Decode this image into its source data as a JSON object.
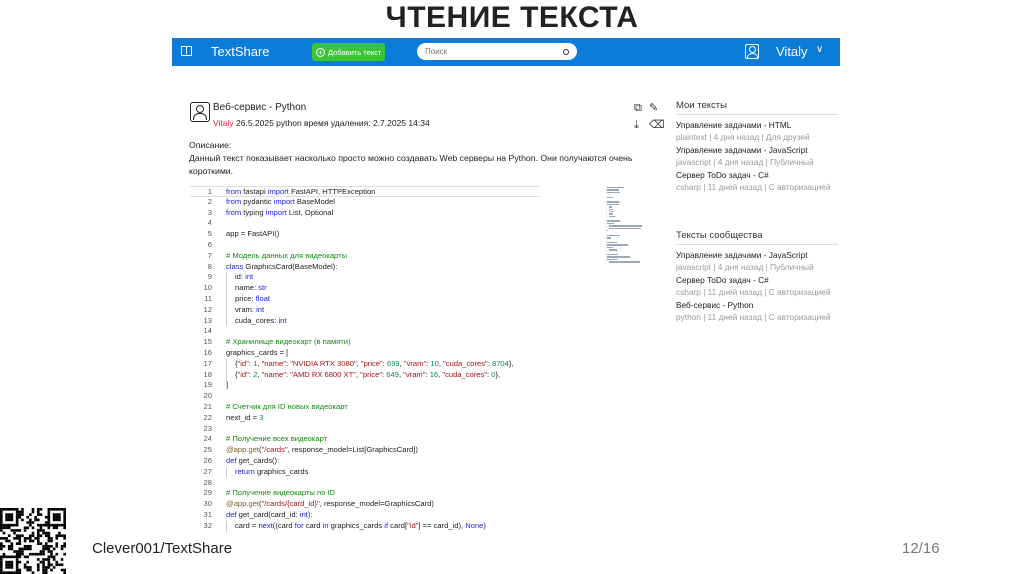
{
  "slide": {
    "title": "ЧТЕНИЕ ТЕКСТА",
    "repo": "Clever001/TextShare",
    "page": "12/16"
  },
  "navbar": {
    "brand": "TextShare",
    "add_button": "Добавить текст",
    "search_placeholder": "Поиск",
    "username": "Vitaly",
    "chevron": "∨"
  },
  "post": {
    "title": "Веб-сервис - Python",
    "author": "Vitaly",
    "meta": " 26.5.2025 python время удаления: 2.7.2025 14:34",
    "desc_label": "Описание:",
    "description": "Данный текст показывает насколько просто можно создавать Web серверы на Python. Они получаются очень короткими.",
    "actions": [
      {
        "name": "copy-icon",
        "glyph": "⧉"
      },
      {
        "name": "edit-icon",
        "glyph": "✎"
      },
      {
        "name": "download-icon",
        "glyph": "⤓"
      },
      {
        "name": "delete-icon",
        "glyph": "⌫"
      }
    ]
  },
  "code": [
    [
      0,
      [
        [
          "k",
          "from"
        ],
        [
          "p",
          " fastapi "
        ],
        [
          "k",
          "import"
        ],
        [
          "p",
          " FastAPI, HTTPException"
        ]
      ]
    ],
    [
      0,
      [
        [
          "k",
          "from"
        ],
        [
          "p",
          " pydantic "
        ],
        [
          "k",
          "import"
        ],
        [
          "p",
          " BaseModel"
        ]
      ]
    ],
    [
      0,
      [
        [
          "k",
          "from"
        ],
        [
          "p",
          " typing "
        ],
        [
          "k",
          "import"
        ],
        [
          "p",
          " List, Optional"
        ]
      ]
    ],
    [
      0,
      []
    ],
    [
      0,
      [
        [
          "p",
          "app = FastAPI()"
        ]
      ]
    ],
    [
      0,
      []
    ],
    [
      0,
      [
        [
          "c",
          "# Модель данных для видеокарты"
        ]
      ]
    ],
    [
      0,
      [
        [
          "k",
          "class"
        ],
        [
          "p",
          " GraphicsCard(BaseModel):"
        ]
      ]
    ],
    [
      1,
      [
        [
          "p",
          "id: "
        ],
        [
          "t",
          "int"
        ]
      ]
    ],
    [
      1,
      [
        [
          "p",
          "name: "
        ],
        [
          "t",
          "str"
        ]
      ]
    ],
    [
      1,
      [
        [
          "p",
          "price: "
        ],
        [
          "t",
          "float"
        ]
      ]
    ],
    [
      1,
      [
        [
          "p",
          "vram: "
        ],
        [
          "t",
          "int"
        ]
      ]
    ],
    [
      1,
      [
        [
          "p",
          "cuda_cores: "
        ],
        [
          "t",
          "int"
        ]
      ]
    ],
    [
      0,
      []
    ],
    [
      0,
      [
        [
          "c",
          "# Хранилище видеокарт (в памяти)"
        ]
      ]
    ],
    [
      0,
      [
        [
          "p",
          "graphics_cards = ["
        ]
      ]
    ],
    [
      1,
      [
        [
          "p",
          "{"
        ],
        [
          "s",
          "\"id\""
        ],
        [
          "p",
          ": "
        ],
        [
          "n",
          "1"
        ],
        [
          "p",
          ", "
        ],
        [
          "s",
          "\"name\""
        ],
        [
          "p",
          ": "
        ],
        [
          "s",
          "\"NVIDIA RTX 3080\""
        ],
        [
          "p",
          ", "
        ],
        [
          "s",
          "\"price\""
        ],
        [
          "p",
          ": "
        ],
        [
          "n",
          "699"
        ],
        [
          "p",
          ", "
        ],
        [
          "s",
          "\"vram\""
        ],
        [
          "p",
          ": "
        ],
        [
          "n",
          "10"
        ],
        [
          "p",
          ", "
        ],
        [
          "s",
          "\"cuda_cores\""
        ],
        [
          "p",
          ": "
        ],
        [
          "n",
          "8704"
        ],
        [
          "p",
          "},"
        ]
      ]
    ],
    [
      1,
      [
        [
          "p",
          "{"
        ],
        [
          "s",
          "\"id\""
        ],
        [
          "p",
          ": "
        ],
        [
          "n",
          "2"
        ],
        [
          "p",
          ", "
        ],
        [
          "s",
          "\"name\""
        ],
        [
          "p",
          ": "
        ],
        [
          "s",
          "\"AMD RX 6800 XT\""
        ],
        [
          "p",
          ", "
        ],
        [
          "s",
          "\"price\""
        ],
        [
          "p",
          ": "
        ],
        [
          "n",
          "649"
        ],
        [
          "p",
          ", "
        ],
        [
          "s",
          "\"vram\""
        ],
        [
          "p",
          ": "
        ],
        [
          "n",
          "16"
        ],
        [
          "p",
          ", "
        ],
        [
          "s",
          "\"cuda_cores\""
        ],
        [
          "p",
          ": "
        ],
        [
          "n",
          "0"
        ],
        [
          "p",
          "},"
        ]
      ]
    ],
    [
      0,
      [
        [
          "p",
          "]"
        ]
      ]
    ],
    [
      0,
      []
    ],
    [
      0,
      [
        [
          "c",
          "# Счетчик для ID новых видеокарт"
        ]
      ]
    ],
    [
      0,
      [
        [
          "p",
          "next_id = "
        ],
        [
          "n",
          "3"
        ]
      ]
    ],
    [
      0,
      []
    ],
    [
      0,
      [
        [
          "c",
          "# Получение всех видеокарт"
        ]
      ]
    ],
    [
      0,
      [
        [
          "d",
          "@app.get"
        ],
        [
          "p",
          "("
        ],
        [
          "s",
          "\"/cards\""
        ],
        [
          "p",
          ", response_model=List[GraphicsCard])"
        ]
      ]
    ],
    [
      0,
      [
        [
          "k",
          "def"
        ],
        [
          "p",
          " get_cards():"
        ]
      ]
    ],
    [
      1,
      [
        [
          "k",
          "return"
        ],
        [
          "p",
          " graphics_cards"
        ]
      ]
    ],
    [
      0,
      []
    ],
    [
      0,
      [
        [
          "c",
          "# Получение видеокарты по ID"
        ]
      ]
    ],
    [
      0,
      [
        [
          "d",
          "@app.get"
        ],
        [
          "p",
          "("
        ],
        [
          "s",
          "\"/cards/{card_id}\""
        ],
        [
          "p",
          ", response_model=GraphicsCard)"
        ]
      ]
    ],
    [
      0,
      [
        [
          "k",
          "def"
        ],
        [
          "p",
          " get_card(card_id: "
        ],
        [
          "t",
          "int"
        ],
        [
          "p",
          "):"
        ]
      ]
    ],
    [
      1,
      [
        [
          "p",
          "card = "
        ],
        [
          "k",
          "next"
        ],
        [
          "p",
          "((card "
        ],
        [
          "k",
          "for"
        ],
        [
          "p",
          " card "
        ],
        [
          "k",
          "in"
        ],
        [
          "p",
          " graphics_cards "
        ],
        [
          "k",
          "if"
        ],
        [
          "p",
          " card["
        ],
        [
          "s",
          "\"id\""
        ],
        [
          "p",
          "] == card_id), "
        ],
        [
          "k",
          "None"
        ],
        [
          "p",
          ")"
        ]
      ]
    ]
  ],
  "sidebar": {
    "my_texts": {
      "title": "Мои тексты",
      "items": [
        {
          "title": "Управление задачами - HTML",
          "meta": "plaintext | 4 дня назад | Для друзей"
        },
        {
          "title": "Управление задачами - JavaScript",
          "meta": "javascript | 4 дня назад | Публичный"
        },
        {
          "title": "Сервер ToDo задач - C#",
          "meta": "csharp | 11 дней назад | С авторизацией"
        }
      ]
    },
    "community": {
      "title": "Тексты сообщества",
      "items": [
        {
          "title": "Управление задачами - JavaScript",
          "meta": "javascript | 4 дня назад | Публичный"
        },
        {
          "title": "Сервер ToDo задач - C#",
          "meta": "csharp | 11 дней назад | С авторизацией"
        },
        {
          "title": "Веб-сервис - Python",
          "meta": "python | 11 дней назад | С авторизацией"
        }
      ]
    }
  }
}
